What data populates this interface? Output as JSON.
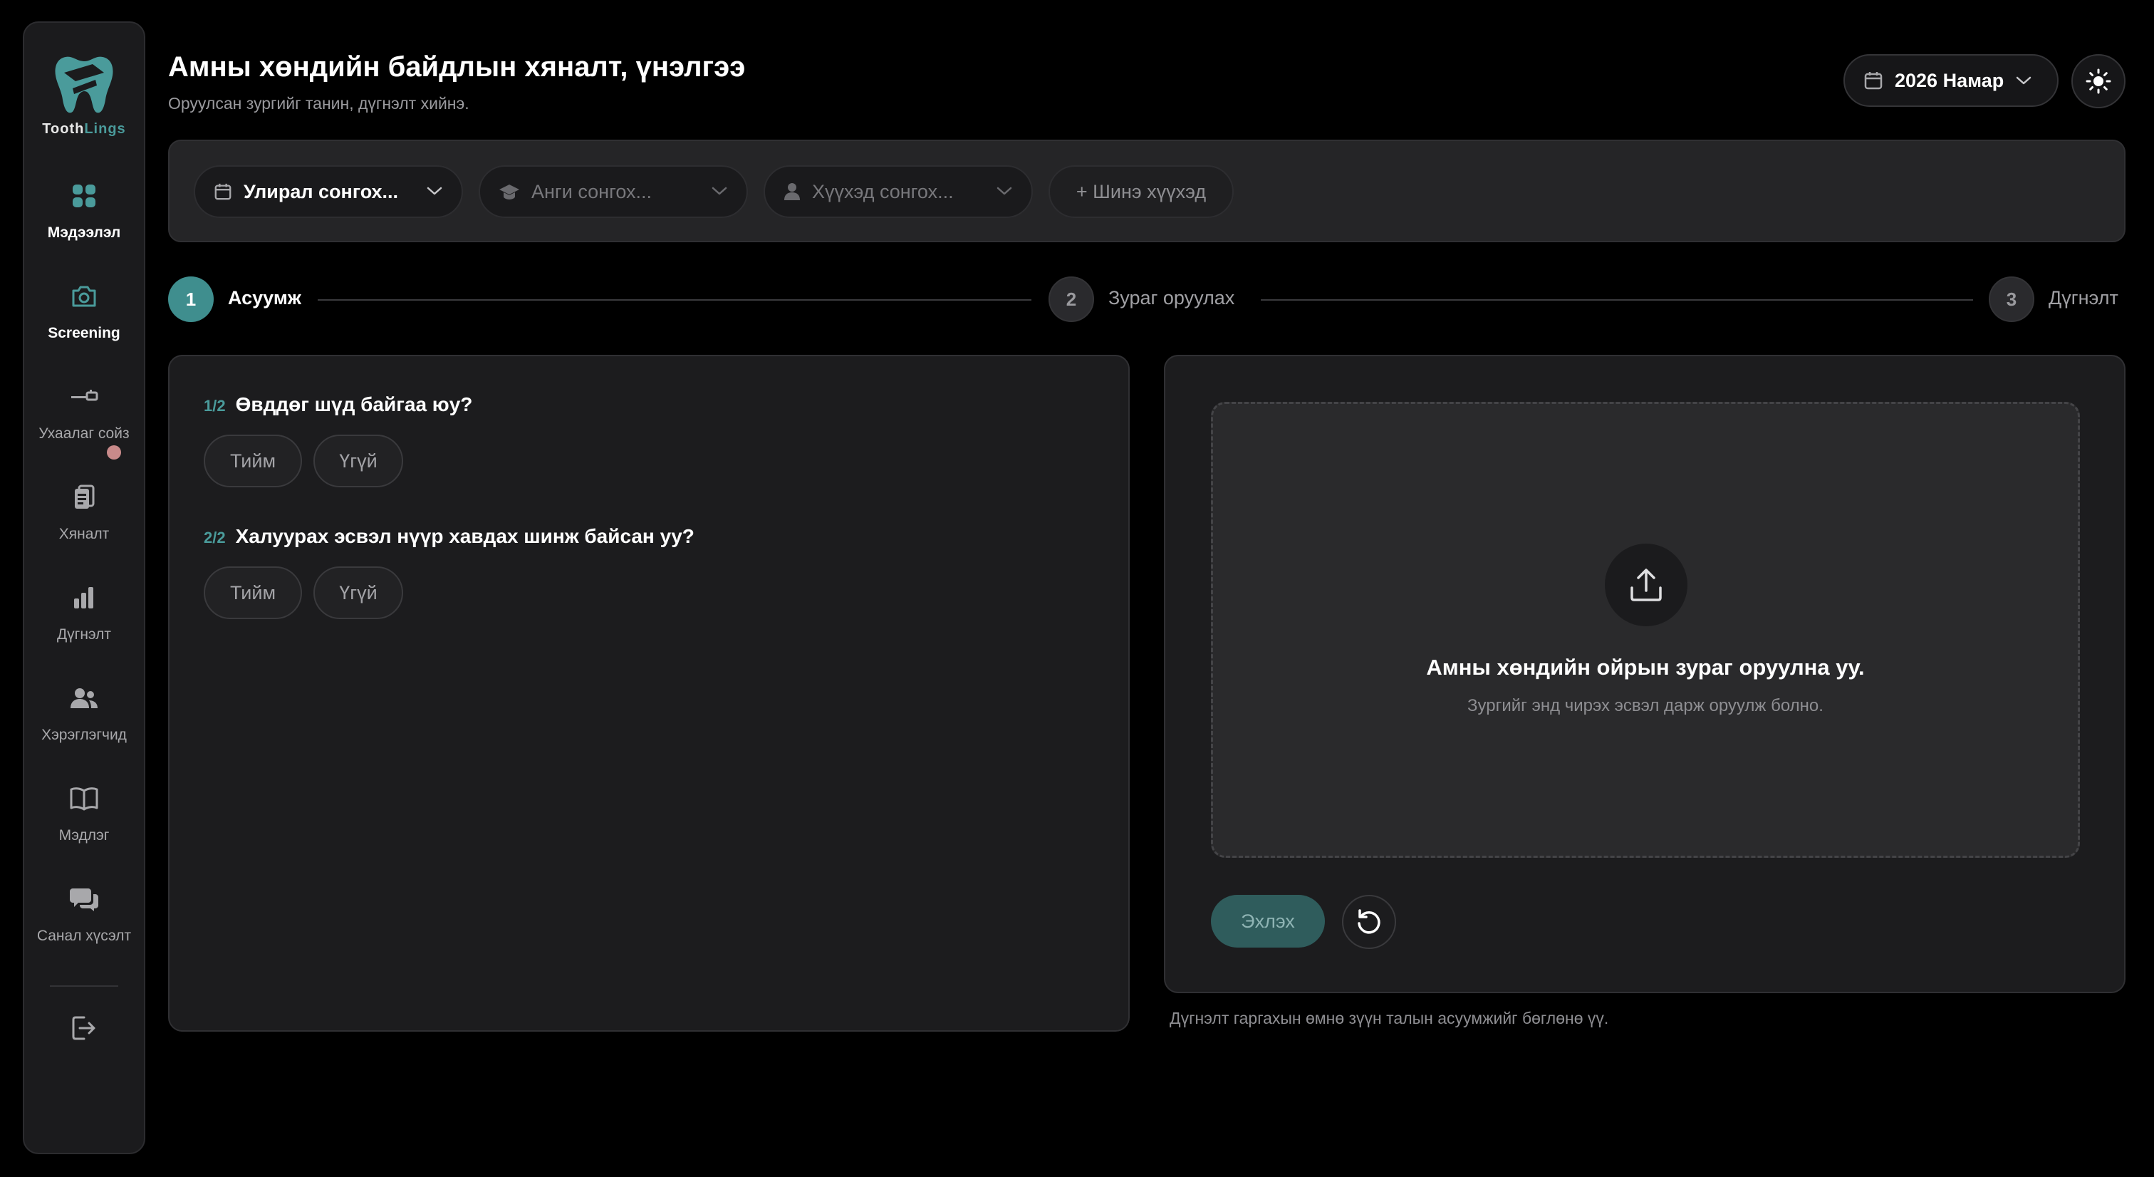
{
  "app": {
    "logo_prefix": "Tooth",
    "logo_suffix": "Lings",
    "accent": "#4a9b9b"
  },
  "sidebar": {
    "items": [
      {
        "label": "Мэдээлэл",
        "icon": "grid-icon",
        "active": true
      },
      {
        "label": "Screening",
        "icon": "camera-icon",
        "active": true
      },
      {
        "label": "Ухаалаг сойз",
        "icon": "toothbrush-icon",
        "active": false
      },
      {
        "label": "Хяналт",
        "icon": "clipboard-icon",
        "active": false
      },
      {
        "label": "Дүгнэлт",
        "icon": "bar-chart-icon",
        "active": false
      },
      {
        "label": "Хэрэглэгчид",
        "icon": "users-icon",
        "active": false
      },
      {
        "label": "Мэдлэг",
        "icon": "book-icon",
        "active": false
      },
      {
        "label": "Санал хүсэлт",
        "icon": "chat-icon",
        "active": false
      }
    ],
    "logout_icon": "logout-icon"
  },
  "header": {
    "title": "Амны хөндийн байдлын хяналт, үнэлгээ",
    "subtitle": "Оруулсан зургийг танин, дүгнэлт хийнэ.",
    "season": "2026 Намар",
    "theme_icon": "sun-icon"
  },
  "filters": {
    "semester": "Улирал сонгох...",
    "class": "Анги сонгох...",
    "child": "Хүүхэд сонгох...",
    "new_child": "+ Шинэ хүүхэд"
  },
  "stepper": [
    {
      "num": "1",
      "label": "Асуумж",
      "active": true
    },
    {
      "num": "2",
      "label": "Зураг оруулах",
      "active": false
    },
    {
      "num": "3",
      "label": "Дүгнэлт",
      "active": false
    }
  ],
  "questions": [
    {
      "num": "1/2",
      "text": "Өвддөг шүд байгаа юу?",
      "yes": "Тийм",
      "no": "Үгүй"
    },
    {
      "num": "2/2",
      "text": "Халуурах эсвэл нүүр хавдах шинж байсан уу?",
      "yes": "Тийм",
      "no": "Үгүй"
    }
  ],
  "upload": {
    "title": "Амны хөндийн ойрын зураг оруулна уу.",
    "subtitle": "Зургийг энд чирэх эсвэл дарж оруулж болно.",
    "start": "Эхлэх",
    "hint": "Дүгнэлт гаргахын өмнө зүүн талын асуумжийг бөглөнө үү."
  }
}
